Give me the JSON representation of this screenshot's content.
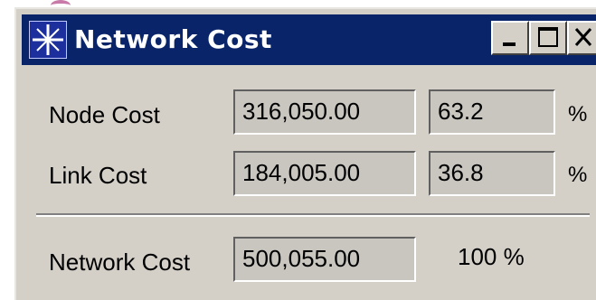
{
  "window": {
    "title": "Network Cost",
    "controls": {
      "minimize": "_",
      "maximize": "□",
      "close": "X"
    }
  },
  "rows": [
    {
      "label": "Node Cost",
      "amount": "316,050.00",
      "percent": "63.2",
      "percent_sign": "%"
    },
    {
      "label": "Link Cost",
      "amount": "184,005.00",
      "percent": "36.8",
      "percent_sign": "%"
    }
  ],
  "total": {
    "label": "Network Cost",
    "amount": "500,055.00",
    "percent_text": "100 %"
  },
  "colors": {
    "title_bar": "#0a246a",
    "window_face": "#d4d0c8",
    "field_bg": "#c9c6c0"
  },
  "icons": [
    "star-app-icon",
    "minimize-icon",
    "maximize-icon",
    "close-icon"
  ]
}
